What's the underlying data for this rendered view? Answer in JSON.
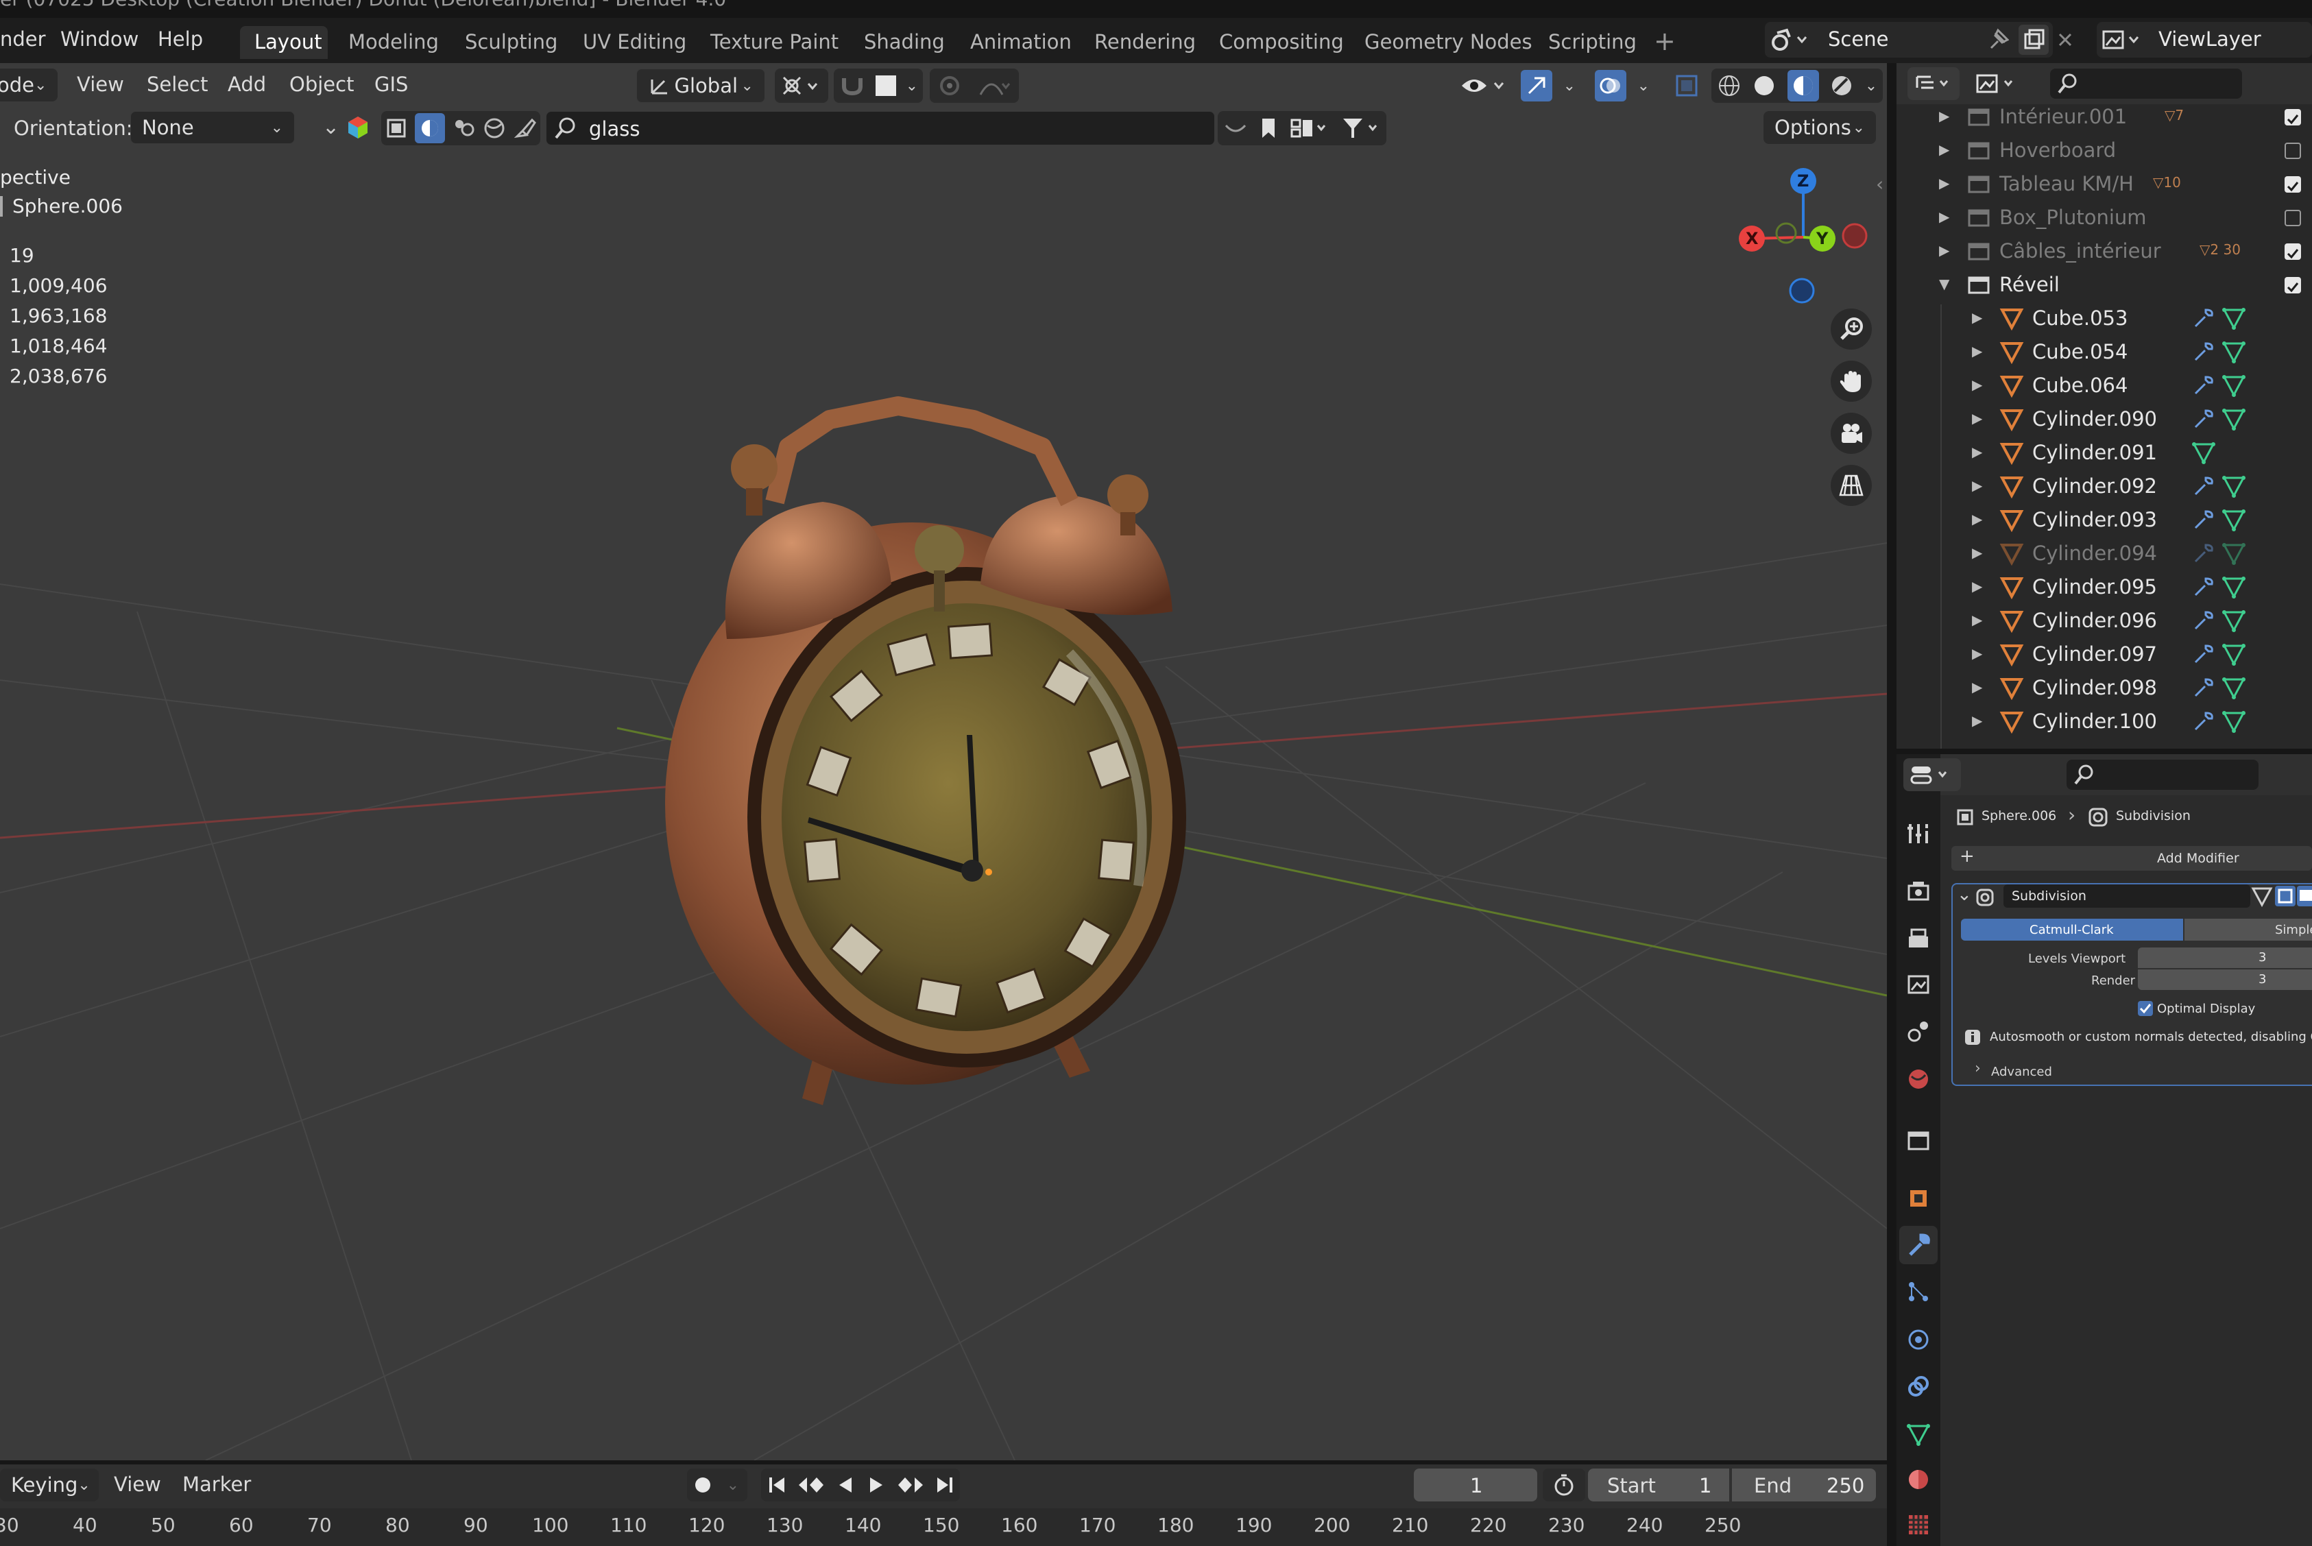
{
  "window_title": "er (07025 Desktop (Création Blender) Donut (Delorean)blend] - Blender 4.0",
  "topbar": {
    "menus": [
      "nder",
      "Window",
      "Help"
    ],
    "workspaces": [
      "Layout",
      "Modeling",
      "Sculpting",
      "UV Editing",
      "Texture Paint",
      "Shading",
      "Animation",
      "Rendering",
      "Compositing",
      "Geometry Nodes",
      "Scripting"
    ],
    "active_workspace": "Layout",
    "add_tab": "+",
    "scene": "Scene",
    "view_layer": "ViewLayer"
  },
  "viewport_header": {
    "mode": "ode",
    "menus": [
      "View",
      "Select",
      "Add",
      "Object",
      "GIS"
    ],
    "transform_orientation": "Global",
    "orientation_label": "Orientation:",
    "orientation_value": "None",
    "search_value": "glass",
    "options_label": "Options"
  },
  "viewport_overlay": {
    "view_name": "pective",
    "object_name": "Sphere.006",
    "stats": [
      "19",
      "1,009,406",
      "1,963,168",
      "1,018,464",
      "2,038,676"
    ]
  },
  "gizmo": {
    "z": "Z",
    "y": "Y",
    "x": "X"
  },
  "outliner": {
    "items": [
      {
        "name": "Intérieur.001",
        "badge": "7",
        "dim": true,
        "expanded": false,
        "indent": 0,
        "type": "collection",
        "checked": true
      },
      {
        "name": "Hoverboard",
        "badge": "",
        "dim": true,
        "expanded": false,
        "indent": 0,
        "type": "collection",
        "checked": false
      },
      {
        "name": "Tableau KM/H",
        "badge": "10",
        "dim": true,
        "expanded": false,
        "indent": 0,
        "type": "collection",
        "checked": true
      },
      {
        "name": "Box_Plutonium",
        "badge": "",
        "dim": true,
        "expanded": false,
        "indent": 0,
        "type": "collection",
        "checked": false
      },
      {
        "name": "Câbles_intérieur",
        "badge": "2 30",
        "dim": true,
        "expanded": false,
        "indent": 0,
        "type": "collection",
        "checked": true
      },
      {
        "name": "Réveil",
        "badge": "",
        "dim": false,
        "expanded": true,
        "indent": 0,
        "type": "collection",
        "checked": true
      },
      {
        "name": "Cube.053",
        "dim": false,
        "indent": 1,
        "type": "mesh",
        "modifier": true
      },
      {
        "name": "Cube.054",
        "dim": false,
        "indent": 1,
        "type": "mesh",
        "modifier": true
      },
      {
        "name": "Cube.064",
        "dim": false,
        "indent": 1,
        "type": "mesh",
        "modifier": true
      },
      {
        "name": "Cylinder.090",
        "dim": false,
        "indent": 1,
        "type": "mesh",
        "modifier": true
      },
      {
        "name": "Cylinder.091",
        "dim": false,
        "indent": 1,
        "type": "mesh",
        "modifier": false
      },
      {
        "name": "Cylinder.092",
        "dim": false,
        "indent": 1,
        "type": "mesh",
        "modifier": true
      },
      {
        "name": "Cylinder.093",
        "dim": false,
        "indent": 1,
        "type": "mesh",
        "modifier": true
      },
      {
        "name": "Cylinder.094",
        "dim": true,
        "indent": 1,
        "type": "mesh",
        "modifier": true
      },
      {
        "name": "Cylinder.095",
        "dim": false,
        "indent": 1,
        "type": "mesh",
        "modifier": true
      },
      {
        "name": "Cylinder.096",
        "dim": false,
        "indent": 1,
        "type": "mesh",
        "modifier": true
      },
      {
        "name": "Cylinder.097",
        "dim": false,
        "indent": 1,
        "type": "mesh",
        "modifier": true
      },
      {
        "name": "Cylinder.098",
        "dim": false,
        "indent": 1,
        "type": "mesh",
        "modifier": true
      },
      {
        "name": "Cylinder.100",
        "dim": false,
        "indent": 1,
        "type": "mesh",
        "modifier": true
      }
    ]
  },
  "properties": {
    "breadcrumb_object": "Sphere.006",
    "breadcrumb_modifier": "Subdivision",
    "add_modifier": "Add Modifier",
    "modifier_name": "Subdivision",
    "type_active": "Catmull-Clark",
    "type_other": "Simple",
    "levels_viewport_label": "Levels Viewport",
    "levels_viewport_value": "3",
    "render_label": "Render",
    "render_value": "3",
    "optimal_display": "Optimal Display",
    "warning": "Autosmooth or custom normals detected, disabling GPU subdivision",
    "advanced": "Advanced"
  },
  "timeline": {
    "keying": "Keying",
    "view": "View",
    "marker": "Marker",
    "current_frame": "1",
    "start_label": "Start",
    "start_value": "1",
    "end_label": "End",
    "end_value": "250",
    "ticks": [
      "30",
      "40",
      "50",
      "60",
      "70",
      "80",
      "90",
      "100",
      "110",
      "120",
      "130",
      "140",
      "150",
      "160",
      "170",
      "180",
      "190",
      "200",
      "210",
      "220",
      "230",
      "240",
      "250"
    ]
  },
  "colors": {
    "accent_blue": "#4772b3",
    "mesh_orange": "#e0803a",
    "modifier_blue": "#6d9de0",
    "data_green": "#3fce8f",
    "axis_x": "#e8413f",
    "axis_y": "#8ad31a",
    "axis_z": "#2f7ee0"
  }
}
